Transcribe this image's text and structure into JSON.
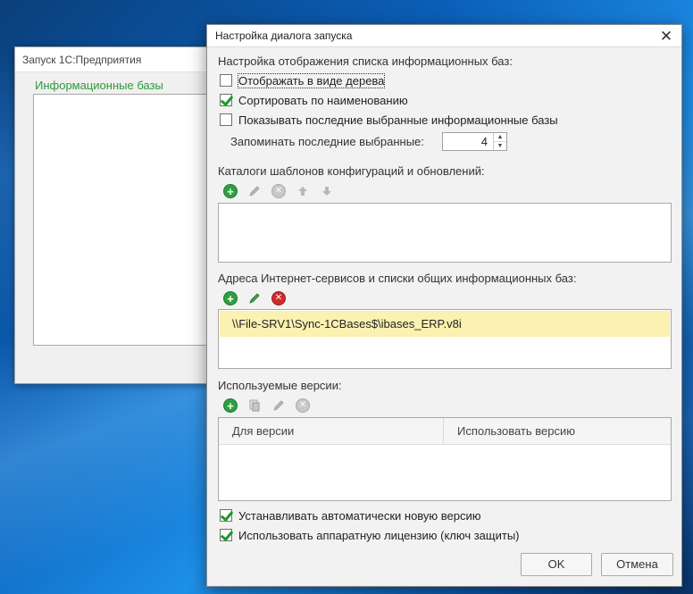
{
  "back_window": {
    "title": "Запуск 1С:Предприятия",
    "list_label": "Информационные базы"
  },
  "dialog": {
    "title": "Настройка диалога запуска",
    "close_symbol": "✕",
    "display_section": {
      "label": "Настройка отображения списка информационных баз:",
      "tree_view": {
        "label": "Отображать в виде дерева",
        "checked": false
      },
      "sort_by_name": {
        "label": "Сортировать по наименованию",
        "checked": true
      },
      "show_recent": {
        "label": "Показывать последние выбранные информационные базы",
        "checked": false
      },
      "remember_recent": {
        "label": "Запоминать последние выбранные:",
        "value": "4"
      }
    },
    "templates_section": {
      "label": "Каталоги шаблонов конфигураций и обновлений:",
      "items": []
    },
    "internet_section": {
      "label": "Адреса Интернет-сервисов и списки общих информационных баз:",
      "items": [
        "\\\\File-SRV1\\Sync-1CBases$\\ibases_ERP.v8i"
      ]
    },
    "versions_section": {
      "label": "Используемые версии:",
      "columns": [
        "Для версии",
        "Использовать версию"
      ],
      "rows": []
    },
    "auto_install": {
      "label": "Устанавливать автоматически новую версию",
      "checked": true
    },
    "hardware_license": {
      "label": "Использовать аппаратную лицензию (ключ защиты)",
      "checked": true
    },
    "buttons": {
      "ok": "OK",
      "cancel": "Отмена"
    }
  },
  "icons": {
    "add": "add-circle-icon",
    "edit": "pencil-icon",
    "delete": "delete-circle-icon",
    "up": "arrow-up-icon",
    "down": "arrow-down-icon",
    "copy": "copy-icon"
  },
  "colors": {
    "accent_green": "#2ea043",
    "delete_red": "#d22a2a",
    "selection_yellow": "#fbf1b0",
    "label_green": "#2b9a3a"
  }
}
